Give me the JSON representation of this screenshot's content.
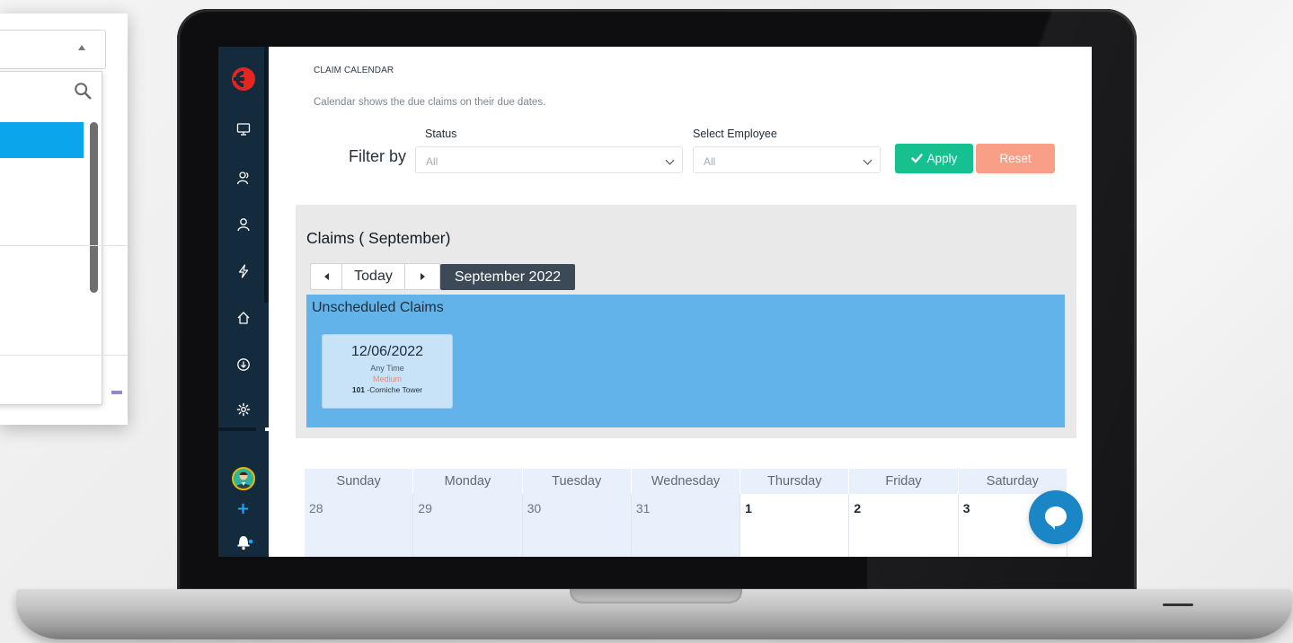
{
  "page": {
    "title": "CLAIM CALENDAR",
    "subtitle": "Calendar shows the due claims on their due dates."
  },
  "filters": {
    "label": "Filter by",
    "status_label": "Status",
    "status_value": "All",
    "employee_label": "Select Employee",
    "employee_value": "All",
    "apply_label": "Apply",
    "reset_label": "Reset"
  },
  "claims": {
    "title": "Claims ( September)",
    "today_label": "Today",
    "month_label": "September 2022",
    "unscheduled_title": "Unscheduled Claims",
    "card": {
      "date": "12/06/2022",
      "time": "Any Time",
      "priority": "Medium",
      "location_id": "101",
      "location_name": "-Corniche Tower"
    }
  },
  "calendar": {
    "weekdays": [
      "Sunday",
      "Monday",
      "Tuesday",
      "Wednesday",
      "Thursday",
      "Friday",
      "Saturday"
    ],
    "first_week": [
      "28",
      "29",
      "30",
      "31",
      "1",
      "2",
      "3"
    ]
  },
  "sidebar": {
    "icons": [
      "monitor-icon",
      "users-icon",
      "user-icon",
      "bolt-icon",
      "home-icon",
      "download-icon",
      "settings-icon"
    ]
  },
  "colors": {
    "sidebar": "#142a3d",
    "apply": "#17c08f",
    "reset": "#f99f87",
    "unscheduled": "#63b3eb",
    "chat": "#1a86c6"
  }
}
